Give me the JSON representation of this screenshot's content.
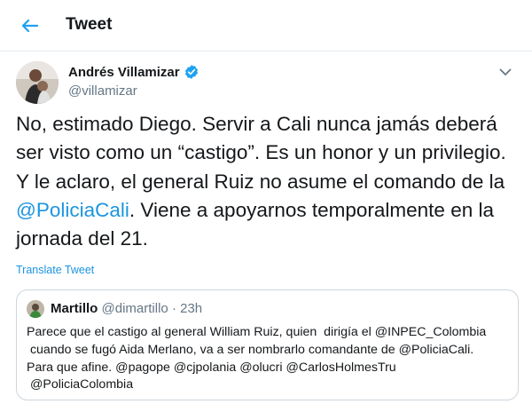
{
  "header": {
    "title": "Tweet",
    "accent_color": "#1da1f2"
  },
  "author": {
    "name": "Andrés Villamizar",
    "handle": "@villamizar",
    "verified": true
  },
  "tweet": {
    "line1": "No, estimado Diego. Servir a Cali nunca jamás deberá",
    "line2": "ser visto como un “castigo”. Es un honor y un privilegio.",
    "line3": "Y le aclaro, el general Ruiz no asume el comando de la",
    "mention": "@PoliciaCali",
    "line4_rest": ". Viene a apoyarnos temporalmente en la",
    "line5": "jornada del 21."
  },
  "translate_label": "Translate Tweet",
  "quoted": {
    "name": "Martillo",
    "handle": "@dimartillo",
    "separator": "·",
    "time": "23h",
    "text": "Parece que el castigo al general William Ruiz, quien  dirigía el @INPEC_Colombia\n cuando se fugó Aida Merlano, va a ser nombrarlo comandante de @PoliciaCali.\nPara que afine. @pagope @cjpolania @olucri @CarlosHolmesTru\n @PoliciaColombia"
  },
  "icons": {
    "back": "arrow-left-icon",
    "verified": "verified-badge-icon",
    "more": "chevron-down-icon"
  }
}
